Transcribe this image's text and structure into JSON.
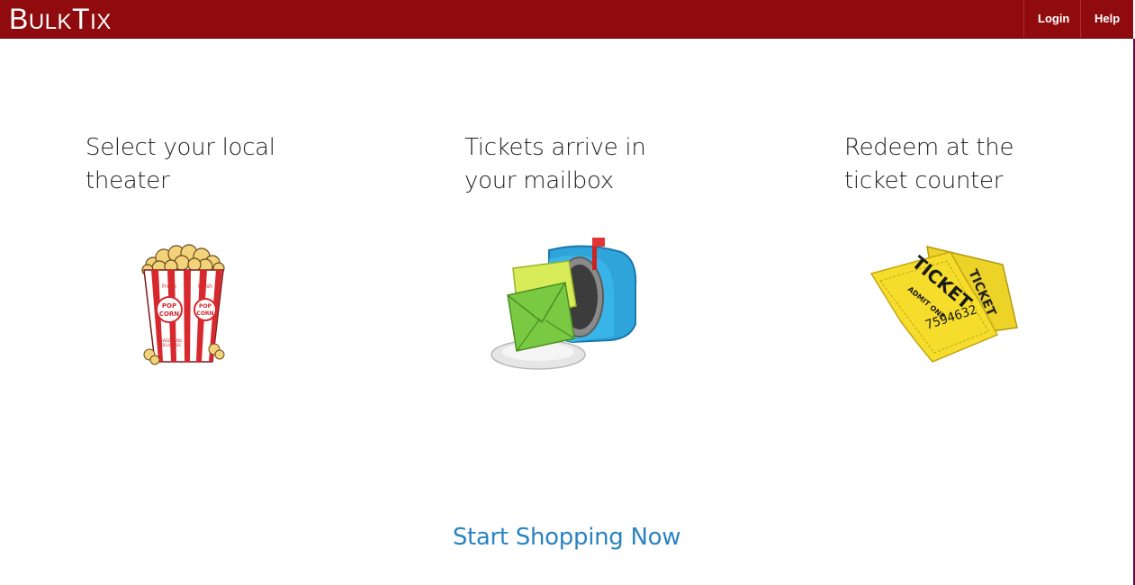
{
  "brand": {
    "first_letter": "B",
    "rest1": "ULK",
    "t": "T",
    "rest2": "IX"
  },
  "nav": {
    "login": "Login",
    "help": "Help"
  },
  "steps": [
    {
      "title": "Select your local theater"
    },
    {
      "title": "Tickets arrive in your mailbox"
    },
    {
      "title": "Redeem at the ticket counter"
    }
  ],
  "illustrations": {
    "popcorn": {
      "word_top": "Fresh",
      "word_main": "POP CORN",
      "word_bottom": "SWEET AND DELICIOUS"
    },
    "ticket": {
      "word": "TICKET",
      "sub": "ADMIT ONE",
      "number": "7594632"
    }
  },
  "cta": {
    "label": "Start Shopping Now"
  },
  "colors": {
    "navbar": "#8f0b0e",
    "accent_link": "#2a84c1",
    "ticket": "#f6dd2b",
    "mailbox": "#2fa4db"
  }
}
